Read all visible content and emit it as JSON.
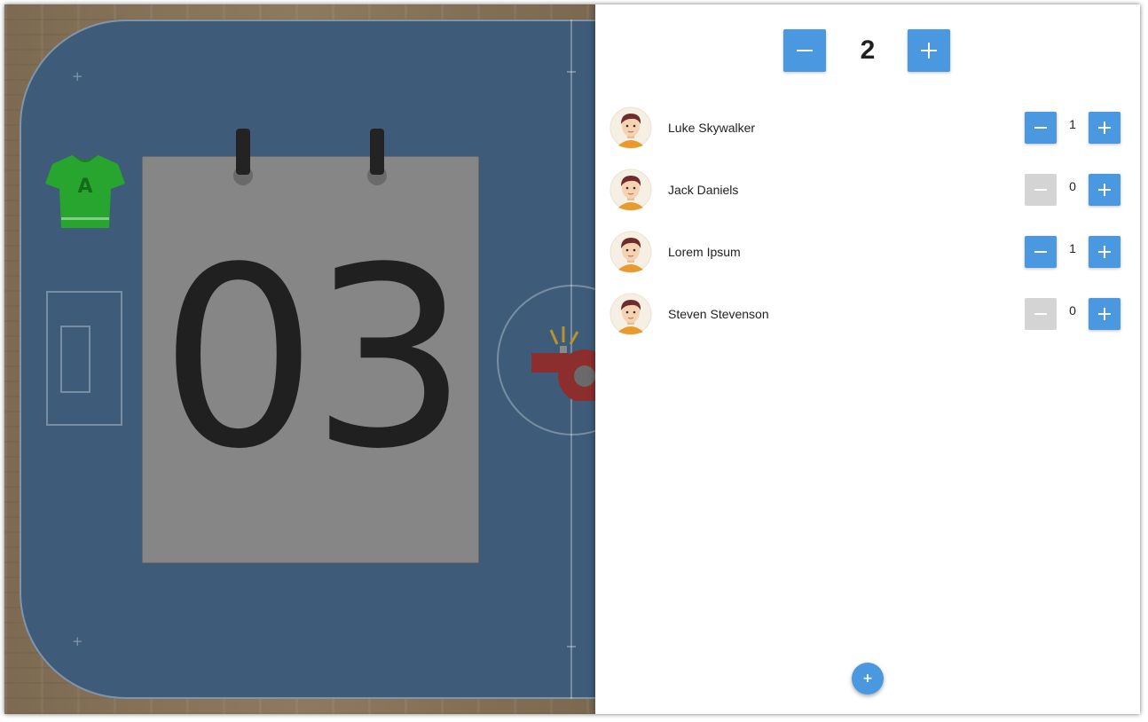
{
  "scoreboard": {
    "score": "03",
    "team_letter": "A",
    "team_color": "#27a52e"
  },
  "period": {
    "value": "2",
    "decrement_icon": "minus-icon",
    "increment_icon": "plus-icon"
  },
  "players": [
    {
      "name": "Luke Skywalker",
      "goals": "1",
      "decrement_enabled": true
    },
    {
      "name": "Jack Daniels",
      "goals": "0",
      "decrement_enabled": false
    },
    {
      "name": "Lorem Ipsum",
      "goals": "1",
      "decrement_enabled": true
    },
    {
      "name": "Steven Stevenson",
      "goals": "0",
      "decrement_enabled": false
    }
  ],
  "add_player": {
    "label": "+"
  },
  "colors": {
    "accent": "#4a98e0",
    "disabled": "#d4d4d4",
    "court": "#3e5c7a",
    "card": "#868686"
  }
}
